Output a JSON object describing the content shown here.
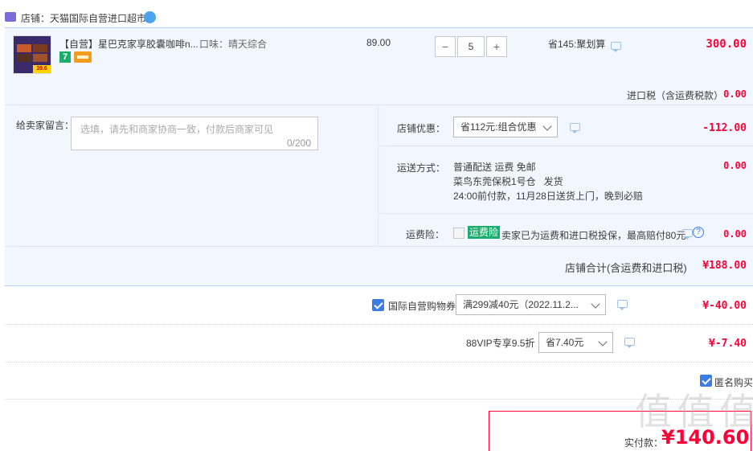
{
  "store": {
    "label": "店铺：天猫国际自营进口超市"
  },
  "item": {
    "title": "【自营】星巴克家享胶囊咖啡n...",
    "thumb_price": "39.6",
    "badge_num": "7",
    "flavor": "口味：晴天综合",
    "unit_price": "89.00",
    "quantity": "5",
    "minus": "−",
    "plus": "+",
    "savings": "省145:聚划算",
    "total": "300.00"
  },
  "import_tax": {
    "label": "进口税（含运费税款）",
    "value": "0.00"
  },
  "message": {
    "label": "给卖家留言：",
    "placeholder": "选填，请先和商家协商一致，付款后商家可见",
    "counter": "0/200"
  },
  "store_discount": {
    "label": "店铺优惠：",
    "selected": "省112元:组合优惠",
    "value": "-112.00"
  },
  "shipping": {
    "label": "运送方式：",
    "line1": "普通配送 运费 免邮",
    "line2": "菜鸟东莞保税1号仓   发货",
    "line3": "24:00前付款，11月28日送货上门，晚到必赔",
    "value": "0.00"
  },
  "freight_insurance": {
    "label": "运费险：",
    "tag": "运费险",
    "desc": "卖家已为运费和进口税投保，最高赔付80元",
    "help": "?",
    "value": "0.00"
  },
  "store_total": {
    "label": "店铺合计(含运费和进口税)",
    "value": "¥188.00"
  },
  "coupon": {
    "label": "国际自营购物券",
    "selected": "满299减40元（2022.11.2...",
    "value": "¥-40.00"
  },
  "vip": {
    "label": "88VIP专享9.5折",
    "selected": "省7.40元",
    "value": "¥-7.40"
  },
  "anonymous": {
    "label": "匿名购买"
  },
  "pay": {
    "label": "实付款：",
    "value": "¥140.60"
  },
  "watermark": {
    "text": "值 值 值"
  },
  "colors": {
    "accent": "#ff0036",
    "link_blue": "#3d7be5",
    "row_bg": "#f2f7ff",
    "row_border": "#b2d1ff"
  }
}
